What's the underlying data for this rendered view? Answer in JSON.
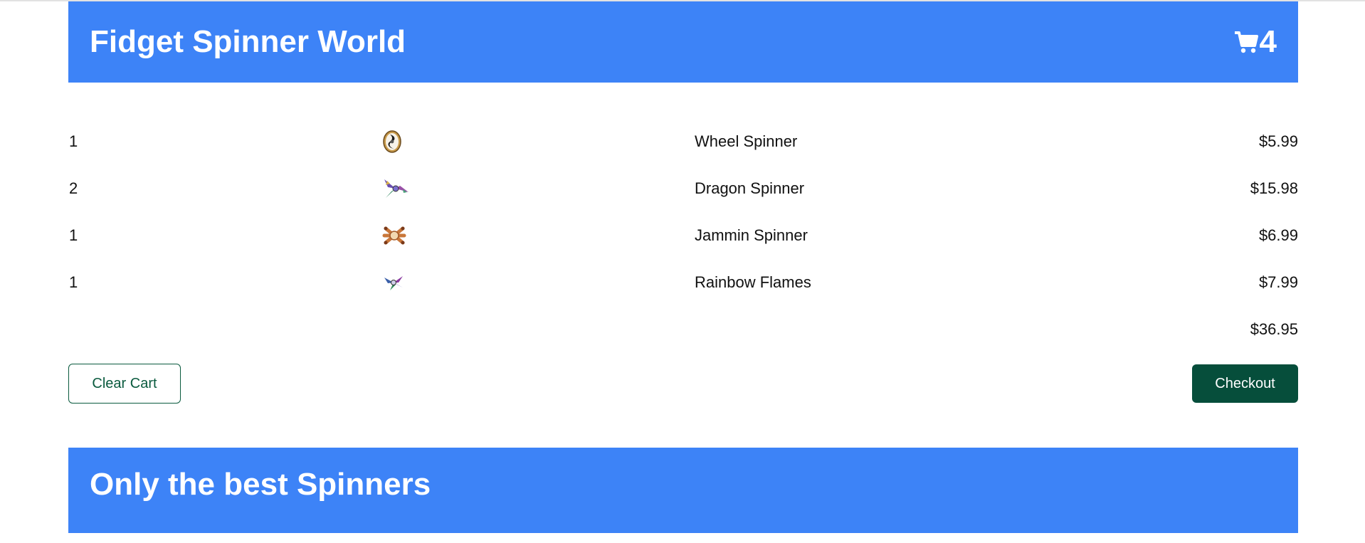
{
  "header": {
    "title": "Fidget Spinner World",
    "cart_count": "4",
    "cart_icon": "shopping-cart-icon"
  },
  "cart": {
    "items": [
      {
        "qty": "1",
        "image": "wheel-spinner-image",
        "name": "Wheel Spinner",
        "price": "$5.99"
      },
      {
        "qty": "2",
        "image": "dragon-spinner-image",
        "name": "Dragon Spinner",
        "price": "$15.98"
      },
      {
        "qty": "1",
        "image": "jammin-spinner-image",
        "name": "Jammin Spinner",
        "price": "$6.99"
      },
      {
        "qty": "1",
        "image": "rainbow-flames-image",
        "name": "Rainbow Flames",
        "price": "$7.99"
      }
    ],
    "total": "$36.95"
  },
  "actions": {
    "clear_label": "Clear Cart",
    "checkout_label": "Checkout"
  },
  "footer": {
    "title": "Only the best Spinners"
  },
  "colors": {
    "banner": "#3d83f7",
    "checkout": "#064e3b",
    "clear_border": "#0a5a3e"
  }
}
